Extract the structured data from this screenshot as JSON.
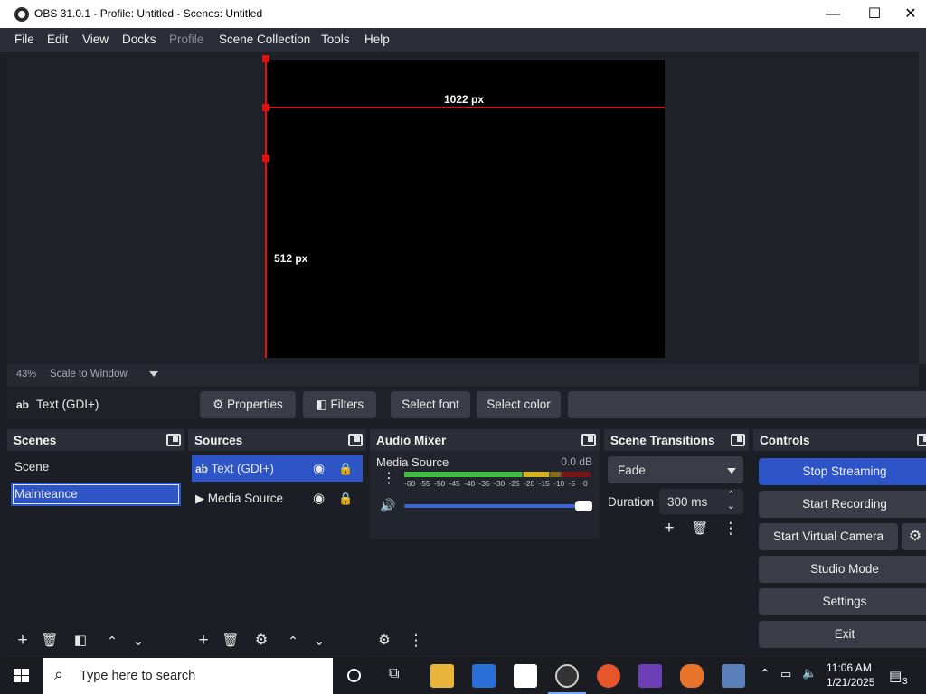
{
  "window": {
    "title": "OBS 31.0.1 - Profile: Untitled - Scenes: Untitled",
    "minimize": "—",
    "maximize": "☐",
    "close": "✕"
  },
  "menu": {
    "file": "File",
    "edit": "Edit",
    "view": "View",
    "docks": "Docks",
    "profile": "Profile",
    "scene_collection": "Scene Collection",
    "tools": "Tools",
    "help": "Help"
  },
  "preview": {
    "width_label": "1022 px",
    "height_label": "512 px",
    "zoom": "43%",
    "scale_mode": "Scale to Window"
  },
  "source_toolbar": {
    "source_icon": "ab",
    "source_name": "Text (GDI+)",
    "properties": "Properties",
    "filters": "Filters",
    "select_font": "Select font",
    "select_color": "Select color"
  },
  "scenes": {
    "title": "Scenes",
    "items": [
      "Scene",
      "Mainteance"
    ],
    "selected": "Mainteance"
  },
  "sources": {
    "title": "Sources",
    "items": [
      {
        "icon": "ab",
        "label": "Text (GDI+)",
        "selected": true
      },
      {
        "icon": "▶",
        "label": "Media Source",
        "selected": false
      }
    ]
  },
  "audio_mixer": {
    "title": "Audio Mixer",
    "channel": "Media Source",
    "level": "0.0 dB",
    "ticks": [
      "-60",
      "-55",
      "-50",
      "-45",
      "-40",
      "-35",
      "-30",
      "-25",
      "-20",
      "-15",
      "-10",
      "-5",
      "0"
    ],
    "volume_fraction": 1.0
  },
  "transitions": {
    "title": "Scene Transitions",
    "selected": "Fade",
    "duration_label": "Duration",
    "duration_value": "300 ms"
  },
  "controls": {
    "title": "Controls",
    "stop_streaming": "Stop Streaming",
    "start_recording": "Start Recording",
    "start_virtual_camera": "Start Virtual Camera",
    "studio_mode": "Studio Mode",
    "settings": "Settings",
    "exit": "Exit"
  },
  "taskbar": {
    "search_placeholder": "Type here to search",
    "time": "11:06 AM",
    "date": "1/21/2025",
    "notifications": "3"
  },
  "colors": {
    "accent": "#2d55c8",
    "guide_red": "#e01010",
    "meter_green": "#3fbf3f",
    "meter_yellow": "#d8b21c",
    "meter_red": "#c02222"
  }
}
